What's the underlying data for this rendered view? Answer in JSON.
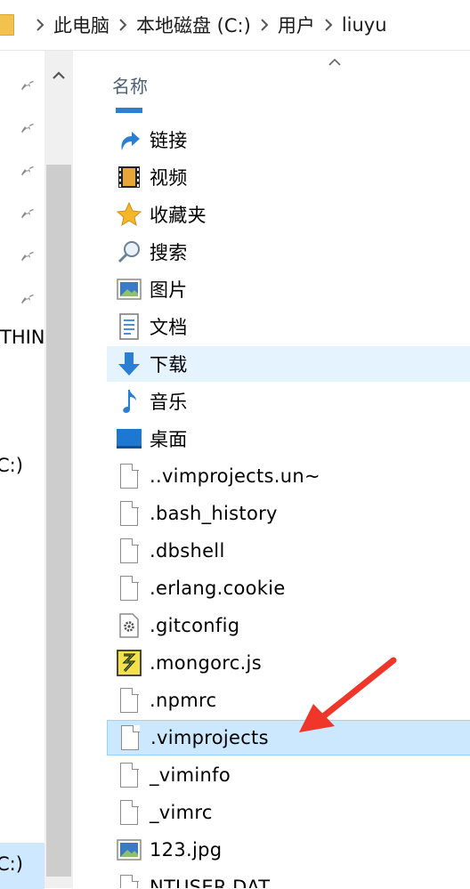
{
  "breadcrumb": [
    "此电脑",
    "本地磁盘 (C:)",
    "用户",
    "liuyu"
  ],
  "nav": {
    "labels": [
      "THIN",
      "C:)",
      "C:)"
    ]
  },
  "columns": {
    "name": "名称"
  },
  "files": [
    {
      "name": "链接",
      "icon": "links-icon"
    },
    {
      "name": "视频",
      "icon": "video-folder-icon"
    },
    {
      "name": "收藏夹",
      "icon": "favorites-star-icon"
    },
    {
      "name": "搜索",
      "icon": "search-icon"
    },
    {
      "name": "图片",
      "icon": "pictures-icon"
    },
    {
      "name": "文档",
      "icon": "documents-icon"
    },
    {
      "name": "下载",
      "icon": "download-arrow-icon"
    },
    {
      "name": "音乐",
      "icon": "music-note-icon"
    },
    {
      "name": "桌面",
      "icon": "desktop-icon"
    },
    {
      "name": "..vimprojects.un~",
      "icon": "file-icon"
    },
    {
      "name": ".bash_history",
      "icon": "file-icon"
    },
    {
      "name": ".dbshell",
      "icon": "file-icon"
    },
    {
      "name": ".erlang.cookie",
      "icon": "file-icon"
    },
    {
      "name": ".gitconfig",
      "icon": "config-file-icon"
    },
    {
      "name": ".mongorc.js",
      "icon": "js-file-icon"
    },
    {
      "name": ".npmrc",
      "icon": "file-icon"
    },
    {
      "name": ".vimprojects",
      "icon": "file-icon"
    },
    {
      "name": "_viminfo",
      "icon": "file-icon"
    },
    {
      "name": "_vimrc",
      "icon": "file-icon"
    },
    {
      "name": "123.jpg",
      "icon": "image-file-icon"
    },
    {
      "name": "NTUSER.DAT",
      "icon": "file-icon"
    }
  ],
  "colors": {
    "selection": "#cce8ff",
    "hover": "#e5f3ff",
    "annotation_arrow": "#f0352a",
    "header_text": "#4c607a"
  }
}
